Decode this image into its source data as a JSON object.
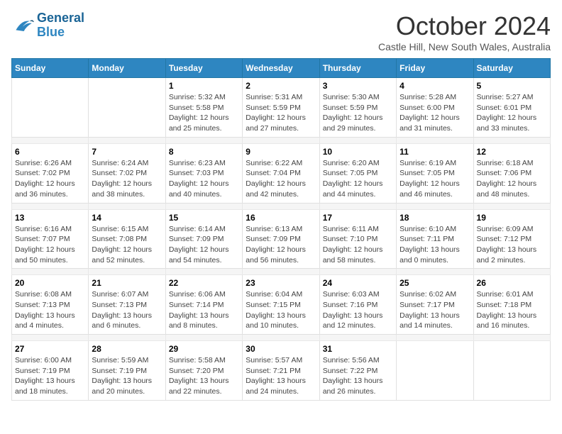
{
  "logo": {
    "line1": "General",
    "line2": "Blue"
  },
  "title": "October 2024",
  "subtitle": "Castle Hill, New South Wales, Australia",
  "days_header": [
    "Sunday",
    "Monday",
    "Tuesday",
    "Wednesday",
    "Thursday",
    "Friday",
    "Saturday"
  ],
  "weeks": [
    [
      {
        "num": "",
        "info": ""
      },
      {
        "num": "",
        "info": ""
      },
      {
        "num": "1",
        "info": "Sunrise: 5:32 AM\nSunset: 5:58 PM\nDaylight: 12 hours\nand 25 minutes."
      },
      {
        "num": "2",
        "info": "Sunrise: 5:31 AM\nSunset: 5:59 PM\nDaylight: 12 hours\nand 27 minutes."
      },
      {
        "num": "3",
        "info": "Sunrise: 5:30 AM\nSunset: 5:59 PM\nDaylight: 12 hours\nand 29 minutes."
      },
      {
        "num": "4",
        "info": "Sunrise: 5:28 AM\nSunset: 6:00 PM\nDaylight: 12 hours\nand 31 minutes."
      },
      {
        "num": "5",
        "info": "Sunrise: 5:27 AM\nSunset: 6:01 PM\nDaylight: 12 hours\nand 33 minutes."
      }
    ],
    [
      {
        "num": "6",
        "info": "Sunrise: 6:26 AM\nSunset: 7:02 PM\nDaylight: 12 hours\nand 36 minutes."
      },
      {
        "num": "7",
        "info": "Sunrise: 6:24 AM\nSunset: 7:02 PM\nDaylight: 12 hours\nand 38 minutes."
      },
      {
        "num": "8",
        "info": "Sunrise: 6:23 AM\nSunset: 7:03 PM\nDaylight: 12 hours\nand 40 minutes."
      },
      {
        "num": "9",
        "info": "Sunrise: 6:22 AM\nSunset: 7:04 PM\nDaylight: 12 hours\nand 42 minutes."
      },
      {
        "num": "10",
        "info": "Sunrise: 6:20 AM\nSunset: 7:05 PM\nDaylight: 12 hours\nand 44 minutes."
      },
      {
        "num": "11",
        "info": "Sunrise: 6:19 AM\nSunset: 7:05 PM\nDaylight: 12 hours\nand 46 minutes."
      },
      {
        "num": "12",
        "info": "Sunrise: 6:18 AM\nSunset: 7:06 PM\nDaylight: 12 hours\nand 48 minutes."
      }
    ],
    [
      {
        "num": "13",
        "info": "Sunrise: 6:16 AM\nSunset: 7:07 PM\nDaylight: 12 hours\nand 50 minutes."
      },
      {
        "num": "14",
        "info": "Sunrise: 6:15 AM\nSunset: 7:08 PM\nDaylight: 12 hours\nand 52 minutes."
      },
      {
        "num": "15",
        "info": "Sunrise: 6:14 AM\nSunset: 7:09 PM\nDaylight: 12 hours\nand 54 minutes."
      },
      {
        "num": "16",
        "info": "Sunrise: 6:13 AM\nSunset: 7:09 PM\nDaylight: 12 hours\nand 56 minutes."
      },
      {
        "num": "17",
        "info": "Sunrise: 6:11 AM\nSunset: 7:10 PM\nDaylight: 12 hours\nand 58 minutes."
      },
      {
        "num": "18",
        "info": "Sunrise: 6:10 AM\nSunset: 7:11 PM\nDaylight: 13 hours\nand 0 minutes."
      },
      {
        "num": "19",
        "info": "Sunrise: 6:09 AM\nSunset: 7:12 PM\nDaylight: 13 hours\nand 2 minutes."
      }
    ],
    [
      {
        "num": "20",
        "info": "Sunrise: 6:08 AM\nSunset: 7:13 PM\nDaylight: 13 hours\nand 4 minutes."
      },
      {
        "num": "21",
        "info": "Sunrise: 6:07 AM\nSunset: 7:13 PM\nDaylight: 13 hours\nand 6 minutes."
      },
      {
        "num": "22",
        "info": "Sunrise: 6:06 AM\nSunset: 7:14 PM\nDaylight: 13 hours\nand 8 minutes."
      },
      {
        "num": "23",
        "info": "Sunrise: 6:04 AM\nSunset: 7:15 PM\nDaylight: 13 hours\nand 10 minutes."
      },
      {
        "num": "24",
        "info": "Sunrise: 6:03 AM\nSunset: 7:16 PM\nDaylight: 13 hours\nand 12 minutes."
      },
      {
        "num": "25",
        "info": "Sunrise: 6:02 AM\nSunset: 7:17 PM\nDaylight: 13 hours\nand 14 minutes."
      },
      {
        "num": "26",
        "info": "Sunrise: 6:01 AM\nSunset: 7:18 PM\nDaylight: 13 hours\nand 16 minutes."
      }
    ],
    [
      {
        "num": "27",
        "info": "Sunrise: 6:00 AM\nSunset: 7:19 PM\nDaylight: 13 hours\nand 18 minutes."
      },
      {
        "num": "28",
        "info": "Sunrise: 5:59 AM\nSunset: 7:19 PM\nDaylight: 13 hours\nand 20 minutes."
      },
      {
        "num": "29",
        "info": "Sunrise: 5:58 AM\nSunset: 7:20 PM\nDaylight: 13 hours\nand 22 minutes."
      },
      {
        "num": "30",
        "info": "Sunrise: 5:57 AM\nSunset: 7:21 PM\nDaylight: 13 hours\nand 24 minutes."
      },
      {
        "num": "31",
        "info": "Sunrise: 5:56 AM\nSunset: 7:22 PM\nDaylight: 13 hours\nand 26 minutes."
      },
      {
        "num": "",
        "info": ""
      },
      {
        "num": "",
        "info": ""
      }
    ]
  ]
}
